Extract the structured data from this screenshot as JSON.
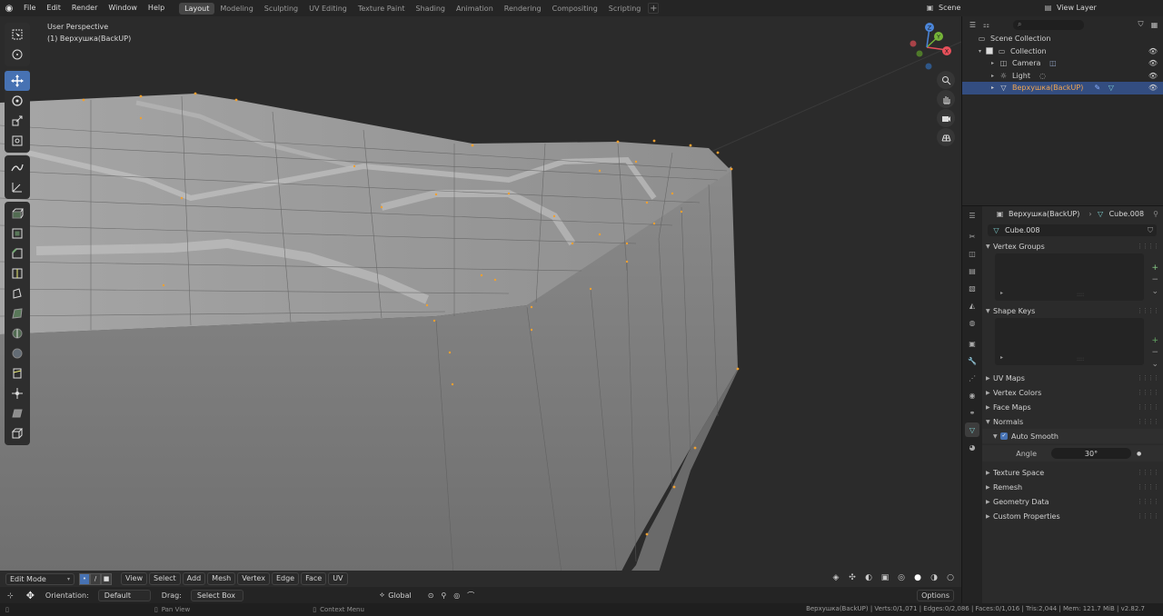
{
  "menu": [
    "File",
    "Edit",
    "Render",
    "Window",
    "Help"
  ],
  "workspaces": [
    "Layout",
    "Modeling",
    "Sculpting",
    "UV Editing",
    "Texture Paint",
    "Shading",
    "Animation",
    "Rendering",
    "Compositing",
    "Scripting"
  ],
  "active_workspace": "Layout",
  "scene_name": "Scene",
  "view_layer": "View Layer",
  "viewport": {
    "view_name": "User Perspective",
    "object_label": "(1) Верхушка(BackUP)",
    "gizmo_axes": [
      "X",
      "Y",
      "Z"
    ],
    "accent_axis_x": "#e8505b",
    "accent_axis_y": "#75b338",
    "accent_axis_z": "#4b85d8",
    "mesh_color": "#9a9a9a",
    "vertex_color": "#f0a030"
  },
  "header": {
    "mode": "Edit Mode",
    "menus": [
      "View",
      "Select",
      "Add",
      "Mesh",
      "Vertex",
      "Edge",
      "Face",
      "UV"
    ]
  },
  "tool_settings": {
    "orientation_label": "Orientation:",
    "orientation_value": "Default",
    "drag_label": "Drag:",
    "drag_value": "Select Box",
    "transform_orientation": "Global",
    "options": "Options"
  },
  "status": {
    "pan": "Pan View",
    "context": "Context Menu",
    "stats": "Верхушка(BackUP) | Verts:0/1,071 | Edges:0/2,086 | Faces:0/1,016 | Tris:2,044 | Mem: 121.7 MiB | v2.82.7"
  },
  "outliner": {
    "search_placeholder": "",
    "root": "Scene Collection",
    "collection": "Collection",
    "items": [
      "Camera",
      "Light",
      "Верхушка(BackUP)"
    ]
  },
  "properties": {
    "object_name": "Верхушка(BackUP)",
    "mesh_name": "Cube.008",
    "datablock": "Cube.008",
    "panels": {
      "vertex_groups": "Vertex Groups",
      "shape_keys": "Shape Keys",
      "uv_maps": "UV Maps",
      "vertex_colors": "Vertex Colors",
      "face_maps": "Face Maps",
      "normals": "Normals",
      "auto_smooth": "Auto Smooth",
      "angle_label": "Angle",
      "angle_value": "30°",
      "texture_space": "Texture Space",
      "remesh": "Remesh",
      "geometry_data": "Geometry Data",
      "custom_properties": "Custom Properties"
    }
  }
}
